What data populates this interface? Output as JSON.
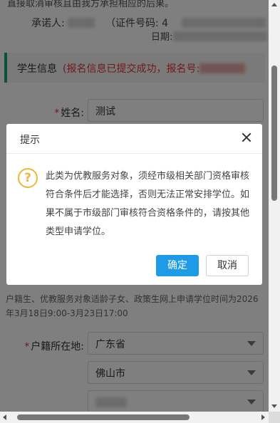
{
  "page": {
    "cut_text": "直接取消审核且由我方承担相应的后果。",
    "commitment": {
      "promisor_label": "承诺人:",
      "id_label": "（证件号码: 4",
      "date_label": "日期:"
    },
    "section": {
      "title": "学生信息",
      "status": "(报名信息已提交成功，报名号:"
    },
    "fields": {
      "name_label": "姓名:",
      "name_value": "测试",
      "hukou_label": "户籍所在地:",
      "province_value": "广东省",
      "city_value": "佛山市"
    },
    "notice": "户籍生、优教服务对象适龄子女、政策生网上申请学位时间为2026年3月18日9:00-3月23日17:00"
  },
  "dialog": {
    "title": "提示",
    "icon": "question-mark-icon",
    "message": "此类为优教服务对象，须经市级相关部门资格审核符合条件后才能选择，否则无法正常安排学位。如果不属于市级部门审核符合资格条件的，请按其他类型申请学位。",
    "confirm_label": "确定",
    "cancel_label": "取消",
    "icon_color": "#f1b53b",
    "confirm_color": "#1d9be6"
  },
  "colors": {
    "accent": "#19a07a",
    "error": "#e23434",
    "required": "#e23434"
  }
}
